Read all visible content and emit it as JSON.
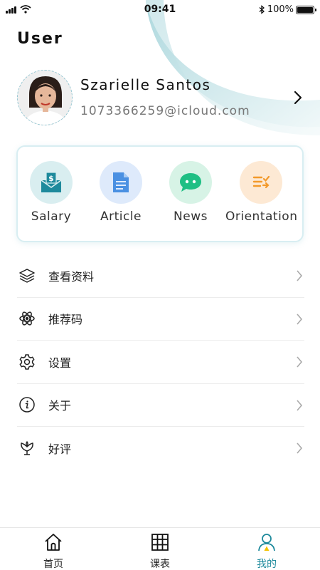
{
  "status_bar": {
    "time": "09:41",
    "battery": "100%",
    "battery_level": 1.0
  },
  "header": {
    "title": "User"
  },
  "profile": {
    "name": "Szarielle Santos",
    "email": "1073366259@icloud.com"
  },
  "quick_actions": [
    {
      "label": "Salary",
      "icon": "salary-envelope-icon",
      "bg": "#d9eef0",
      "color": "#1e8a9c"
    },
    {
      "label": "Article",
      "icon": "document-icon",
      "bg": "#deeafb",
      "color": "#4a90e2"
    },
    {
      "label": "News",
      "icon": "chat-bubble-icon",
      "bg": "#d7f3e6",
      "color": "#1fbf84"
    },
    {
      "label": "Orientation",
      "icon": "list-icon",
      "bg": "#fde9d4",
      "color": "#f39a2b"
    }
  ],
  "menu": [
    {
      "label": "查看资料",
      "icon": "layers-icon"
    },
    {
      "label": "推荐码",
      "icon": "atom-icon"
    },
    {
      "label": "设置",
      "icon": "gear-icon"
    },
    {
      "label": "关于",
      "icon": "info-icon"
    },
    {
      "label": "好评",
      "icon": "flower-icon"
    }
  ],
  "tab_bar": [
    {
      "label": "首页",
      "icon": "home-icon",
      "active": false
    },
    {
      "label": "课表",
      "icon": "timetable-icon",
      "active": false
    },
    {
      "label": "我的",
      "icon": "profile-icon",
      "active": true
    }
  ],
  "colors": {
    "accent": "#1e8a9c",
    "arc": "#cde7ea"
  }
}
